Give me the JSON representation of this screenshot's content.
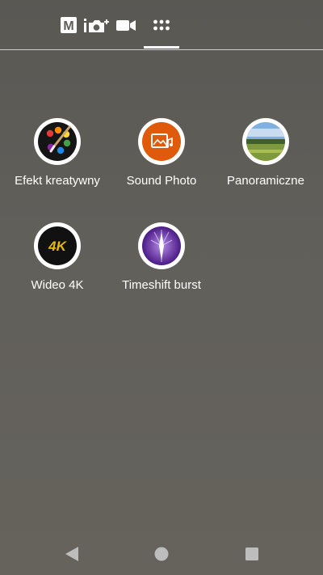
{
  "mode_bar": {
    "manual_label": "M",
    "icons": [
      "manual-mode-icon",
      "superior-auto-icon",
      "video-camera-icon",
      "more-modes-icon"
    ]
  },
  "apps": [
    {
      "label": "Efekt kreatywny",
      "icon": "palette-icon"
    },
    {
      "label": "Sound Photo",
      "icon": "sound-photo-icon"
    },
    {
      "label": "Panoramiczne",
      "icon": "panorama-icon"
    },
    {
      "label": "Wideo 4K",
      "icon": "video-4k-icon",
      "badge_text": "4K"
    },
    {
      "label": "Timeshift burst",
      "icon": "timeshift-burst-icon"
    }
  ],
  "nav_bar": {
    "icons": [
      "back-icon",
      "home-icon",
      "recents-icon"
    ]
  },
  "colors": {
    "background": "#605e59",
    "badge_border": "#ffffff",
    "sound_photo": "#e05a0c",
    "timeshift": "#6a2aa8",
    "gold_4k": "#e6b800"
  }
}
